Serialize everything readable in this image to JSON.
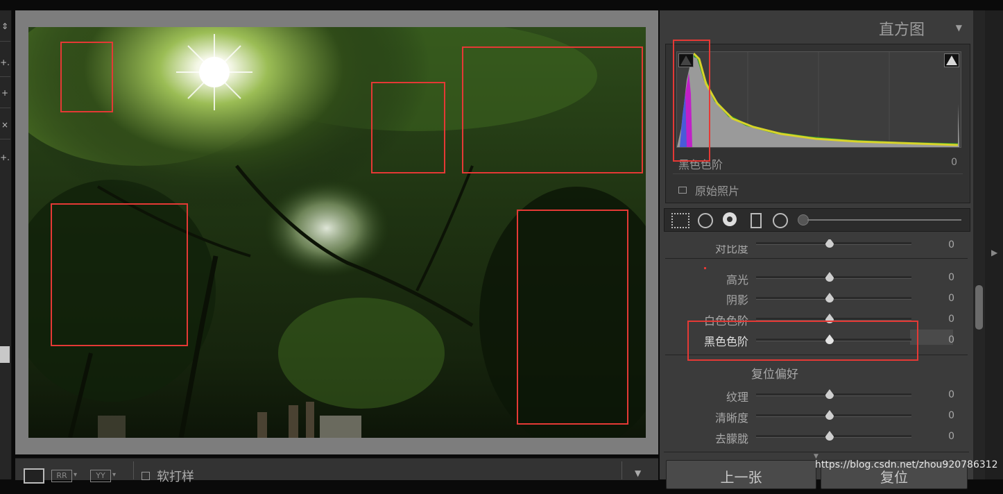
{
  "histogram": {
    "title": "直方图",
    "collapse_icon": "triangle-down-icon",
    "readout_label": "黑色色阶",
    "readout_value": "0",
    "original_photo_label": "原始照片"
  },
  "sliders": [
    {
      "label": "对比度",
      "value": "0"
    },
    {
      "label": "高光",
      "value": "0"
    },
    {
      "label": "阴影",
      "value": "0"
    },
    {
      "label": "白色色阶",
      "value": "0"
    },
    {
      "label": "黑色色阶",
      "value": "0"
    }
  ],
  "presence": {
    "reset_label": "复位偏好",
    "sliders": [
      {
        "label": "纹理",
        "value": "0"
      },
      {
        "label": "清晰度",
        "value": "0"
      },
      {
        "label": "去朦胧",
        "value": "0"
      }
    ]
  },
  "bottom_toolbar": {
    "soft_proof_label": "软打样",
    "view_icons": [
      "loupe-view-icon",
      "before-after-icon",
      "yy-compare-icon"
    ]
  },
  "buttons": {
    "previous_label": "上一张",
    "reset_label": "复位"
  },
  "watermark": "https://blog.csdn.net/zhou920786312",
  "colors": {
    "highlight_box": "#e53935",
    "panel_bg": "#3b3b3b"
  }
}
